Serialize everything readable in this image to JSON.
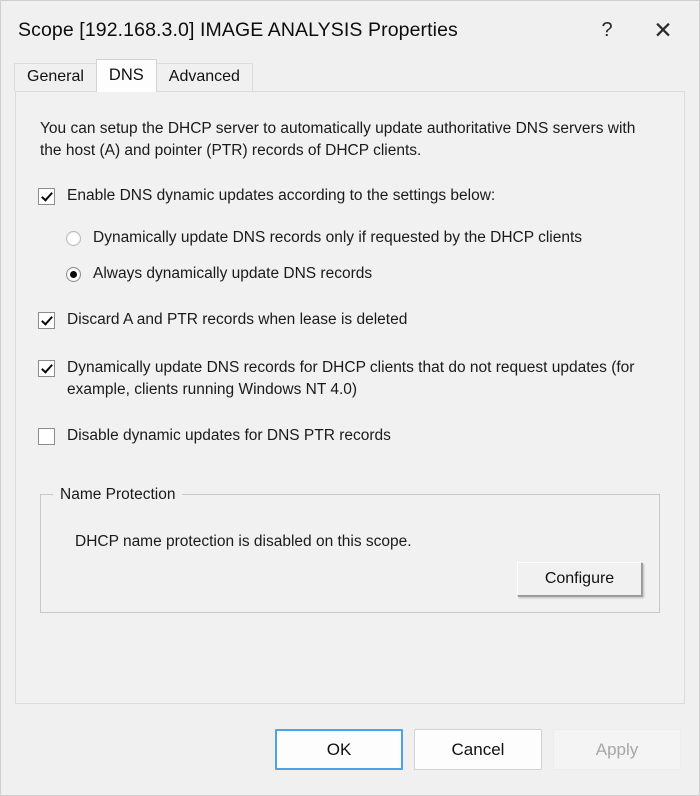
{
  "window": {
    "title": "Scope [192.168.3.0] IMAGE ANALYSIS Properties",
    "help_icon": "?",
    "close_icon": "✕"
  },
  "tabs": [
    {
      "label": "General",
      "selected": false
    },
    {
      "label": "DNS",
      "selected": true
    },
    {
      "label": "Advanced",
      "selected": false
    }
  ],
  "dns_tab": {
    "intro": "You can setup the DHCP server to automatically update authoritative DNS servers with the host (A) and pointer (PTR) records of DHCP clients.",
    "enable_updates": {
      "label": "Enable DNS dynamic updates according to the settings below:",
      "checked": true
    },
    "update_mode": {
      "options": [
        {
          "label": "Dynamically update DNS records only if requested by the DHCP clients",
          "selected": false
        },
        {
          "label": "Always dynamically update DNS records",
          "selected": true
        }
      ]
    },
    "discard_records": {
      "label": "Discard A and PTR records when lease is deleted",
      "checked": true
    },
    "update_non_requesting": {
      "label": "Dynamically update DNS records for DHCP clients that do not request updates (for example, clients running Windows NT 4.0)",
      "checked": true
    },
    "disable_ptr_updates": {
      "label": "Disable dynamic updates for DNS PTR records",
      "checked": false
    },
    "name_protection": {
      "legend": "Name Protection",
      "status": "DHCP name protection is disabled on this scope.",
      "configure_label": "Configure"
    }
  },
  "footer": {
    "ok_label": "OK",
    "cancel_label": "Cancel",
    "apply_label": "Apply",
    "apply_disabled": true
  },
  "colors": {
    "dialog_background": "#f0f0f0",
    "panel_background": "#f1f1f1",
    "tab_selected_background": "#fdfdfd",
    "focus_border": "#4da3e8",
    "disabled_text": "#a6a6a6"
  }
}
